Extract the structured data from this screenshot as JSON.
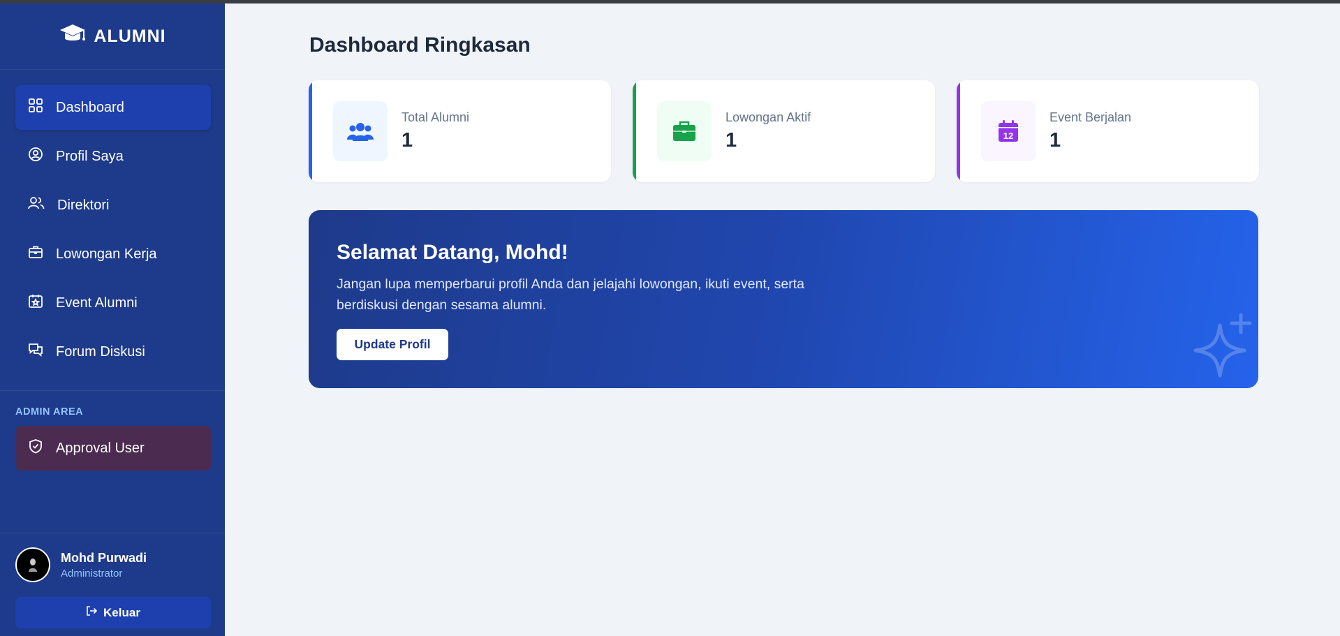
{
  "app": {
    "brand": "ALUMNI"
  },
  "sidebar": {
    "items": [
      {
        "label": "Dashboard",
        "icon": "grid-icon",
        "active": true
      },
      {
        "label": "Profil Saya",
        "icon": "user-circle-icon"
      },
      {
        "label": "Direktori",
        "icon": "users-icon"
      },
      {
        "label": "Lowongan Kerja",
        "icon": "briefcase-icon"
      },
      {
        "label": "Event Alumni",
        "icon": "calendar-star-icon"
      },
      {
        "label": "Forum Diskusi",
        "icon": "chat-icon"
      }
    ],
    "admin_section_label": "ADMIN AREA",
    "admin_items": [
      {
        "label": "Approval User",
        "icon": "shield-check-icon"
      }
    ],
    "user": {
      "name": "Mohd Purwadi",
      "role": "Administrator"
    },
    "logout_label": "Keluar"
  },
  "main": {
    "title": "Dashboard Ringkasan",
    "stats": [
      {
        "label": "Total Alumni",
        "value": "1",
        "accent": "#2563eb",
        "icon": "users-group-icon",
        "icon_bg": "#eff6ff"
      },
      {
        "label": "Lowongan Aktif",
        "value": "1",
        "accent": "#16a34a",
        "icon": "briefcase-icon",
        "icon_bg": "#f0fdf4"
      },
      {
        "label": "Event Berjalan",
        "value": "1",
        "accent": "#9333ea",
        "icon": "calendar-icon",
        "icon_bg": "#faf5ff",
        "icon_text": "12"
      }
    ],
    "welcome": {
      "title": "Selamat Datang, Mohd!",
      "text": "Jangan lupa memperbarui profil Anda dan jelajahi lowongan, ikuti event, serta berdiskusi dengan sesama alumni.",
      "button_label": "Update Profil"
    }
  }
}
